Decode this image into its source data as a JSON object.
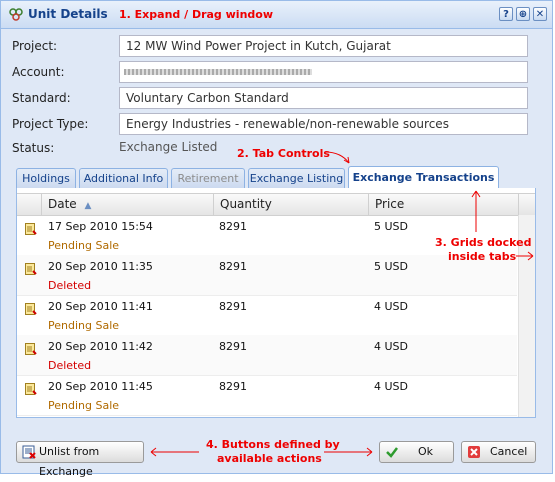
{
  "window": {
    "title": "Unit Details",
    "buttons": [
      "?",
      "⊕",
      "✕"
    ]
  },
  "annotations": {
    "a1": "1. Expand / Drag window",
    "a2": "2. Tab Controls",
    "a3_line1": "3. Grids docked",
    "a3_line2": "inside tabs",
    "a4_line1": "4. Buttons defined by",
    "a4_line2": "available actions"
  },
  "form": {
    "project_label": "Project:",
    "project_value": "12 MW Wind Power Project in Kutch, Gujarat",
    "account_label": "Account:",
    "account_value": "",
    "standard_label": "Standard:",
    "standard_value": "Voluntary Carbon Standard",
    "type_label": "Project Type:",
    "type_value": "Energy Industries - renewable/non-renewable sources",
    "status_label": "Status:",
    "status_value": "Exchange Listed"
  },
  "tabs": [
    {
      "label": "Holdings",
      "state": "normal"
    },
    {
      "label": "Additional Info",
      "state": "normal"
    },
    {
      "label": "Retirement",
      "state": "disabled"
    },
    {
      "label": "Exchange Listing",
      "state": "normal"
    },
    {
      "label": "Exchange Transactions",
      "state": "active"
    }
  ],
  "grid": {
    "columns": [
      "Date",
      "Quantity",
      "Price"
    ],
    "rows": [
      {
        "date": "17 Sep 2010 15:54",
        "quantity": "8291",
        "price": "5 USD",
        "status": "Pending Sale"
      },
      {
        "date": "20 Sep 2010 11:35",
        "quantity": "8291",
        "price": "5 USD",
        "status": "Deleted"
      },
      {
        "date": "20 Sep 2010 11:41",
        "quantity": "8291",
        "price": "4 USD",
        "status": "Pending Sale"
      },
      {
        "date": "20 Sep 2010 11:42",
        "quantity": "8291",
        "price": "4 USD",
        "status": "Deleted"
      },
      {
        "date": "20 Sep 2010 11:45",
        "quantity": "8291",
        "price": "4 USD",
        "status": "Pending Sale"
      }
    ]
  },
  "actions": {
    "unlist_label": "Unlist from Exchange",
    "ok_label": "Ok",
    "cancel_label": "Cancel"
  },
  "colors": {
    "accent": "#15428b",
    "annotation": "#ee0000",
    "pending": "#b06a00",
    "deleted": "#d40000"
  }
}
